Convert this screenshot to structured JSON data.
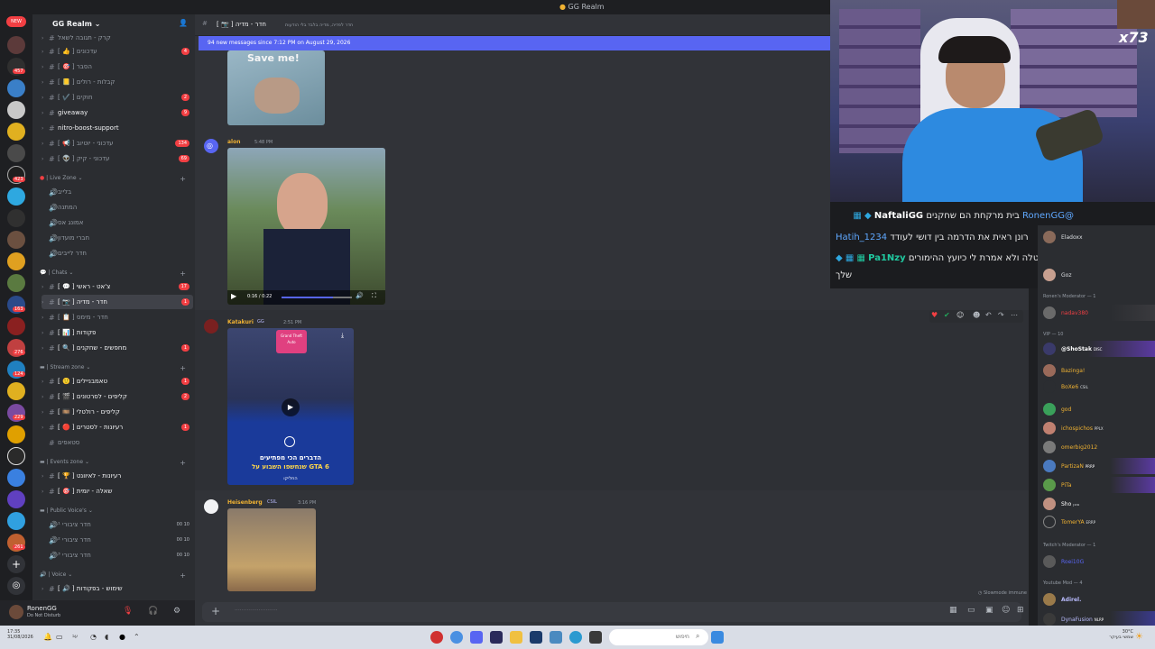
{
  "window": {
    "title": "GG Realm"
  },
  "server": {
    "name": "GG Realm",
    "badges": [
      "NEW",
      "423",
      "457",
      "163",
      "276",
      "124",
      "229",
      "261"
    ]
  },
  "channels": [
    {
      "label": "קרק - תגובה לשאל",
      "type": "text"
    },
    {
      "label": "[ 👍 ] עדכונים",
      "badge": "4"
    },
    {
      "label": "[ 🎯 ] הסבר"
    },
    {
      "label": "[ 📒 ] קבלות - רולים"
    },
    {
      "label": "[ ✔️ ] חוקים",
      "badge": "2"
    },
    {
      "label": "giveaway",
      "badge": "9"
    },
    {
      "label": "nitro-boost-support"
    },
    {
      "label": "[ 📢 ] עדכוני - יוטיוב",
      "badge": "134"
    },
    {
      "label": "[ 👽 ] עדכוני - קיק",
      "badge": "69"
    }
  ],
  "live_zone": {
    "title": "Live Zone",
    "items": [
      "בלייב",
      "המתנה",
      "אמונג אס",
      "חברי מועדון",
      "חדר לייבים"
    ]
  },
  "chats": {
    "title": "Chats",
    "items": [
      {
        "label": "[ 💬 ] צ'אט - ראשי",
        "badge": "17"
      },
      {
        "label": "[ 📷 ] חדר - מדיה",
        "badge": "1",
        "selected": true
      },
      {
        "label": "[ 📋 ] חדר - מימס"
      },
      {
        "label": "[ 📊 ] פקודות"
      },
      {
        "label": "[ 🔍 ] מחפשים - שחקנים",
        "badge": "1"
      }
    ]
  },
  "stream_zone": {
    "title": "Stream zone",
    "items": [
      {
        "label": "[ 🙂 ] טאמבניילים",
        "badge": "1"
      },
      {
        "label": "[ 🎬 ] קליפים - לסרטונים",
        "badge": "2"
      },
      {
        "label": "[ 🎞️ ] קליפים - רולטלי"
      },
      {
        "label": "[ 🔴 ] רעיונות - לסטרים",
        "badge": "1"
      },
      {
        "label": "סטאפים"
      }
    ]
  },
  "events_zone": {
    "title": "Events zone",
    "items": [
      {
        "label": "[ 🏆 ] רעיונות - לאיוונט"
      },
      {
        "label": "[ 🎯 ] שאלה - יומית"
      }
    ]
  },
  "public_voice": {
    "title": "Public Voice's",
    "items": [
      {
        "label": "חדר ציבורי ¹",
        "count": "00 10"
      },
      {
        "label": "חדר ציבורי ²",
        "count": "00 10"
      },
      {
        "label": "חדר ציבורי ³",
        "count": "00 10"
      }
    ]
  },
  "voice": {
    "title": "Voice",
    "items": [
      {
        "label": "[ 🔊 ] שימוש - בפקודות"
      }
    ]
  },
  "user": {
    "name": "RonenGG",
    "status": "Do Not Disturb"
  },
  "channel_header": {
    "name": "[ 📷 ] חדר - מדיה",
    "topic": "חדר לפדיה, מדיה בלבד בלי הודעות"
  },
  "new_messages_bar": "94 new messages since 7:12 PM on August 29, 2026",
  "messages": [
    {
      "author": "",
      "time": "",
      "image_text": "Save me!"
    },
    {
      "author": "alon",
      "time": "5:48 PM",
      "video_time": "0:16 / 0:22"
    },
    {
      "author": "Katakuri",
      "tag": "GG",
      "time": "2:51 PM",
      "image_text_1": "הדברים הכי מפתיעים",
      "image_text_2": "שנחשפו השבוע על GTA 6",
      "image_text_3": "החליקו",
      "gta_text": "Grand Theft Auto"
    },
    {
      "author": "Heisenberg",
      "tag": "CSIL",
      "time": "3:16 PM"
    }
  ],
  "composer": {
    "placeholder": "·························"
  },
  "slowmode": "Slowmode immune",
  "webcam": {
    "overlay_text": "x73"
  },
  "twitch_chat": [
    {
      "user": "NaftaliGG",
      "text": "בית מרקחת הם שחקנים",
      "mention": "@RonenGG"
    },
    {
      "user": "Hatih_1234",
      "text": "רונן ראית את הדרמה בין דושי לעודד"
    },
    {
      "user": "Pa1Nzy",
      "text": "פה שיש חסות חדשה? נסטלה ולא אמרת לי כיועץ ההימורים",
      "text2": "שלך"
    }
  ],
  "members": {
    "top": [
      "Eladoxx",
      "Goz"
    ],
    "groups": [
      {
        "title": "Ronen's Moderator — 1",
        "items": [
          {
            "name": "nadav380",
            "color": "#f23f43"
          }
        ]
      },
      {
        "title": "VIP — 10",
        "items": [
          {
            "name": "@ShoStak",
            "tag": "DISC",
            "color": "#ffffff",
            "sub": "2key"
          },
          {
            "name": "Bazinga!",
            "color": "#f0b232"
          },
          {
            "name": "BoXe6",
            "tag": "CSIL",
            "color": "#f0b232"
          },
          {
            "name": "god",
            "color": "#f0b232"
          },
          {
            "name": "ichospichos",
            "tag": "PPLX",
            "color": "#f0b232"
          },
          {
            "name": "omerbig2012",
            "color": "#f0b232"
          },
          {
            "name": "PartizaN",
            "tag": "PRRP",
            "color": "#f0b232"
          },
          {
            "name": "PiTa",
            "color": "#f0b232"
          },
          {
            "name": "Sho",
            "tag": "סוכן",
            "color": "#ffffff"
          },
          {
            "name": "TomerYA",
            "tag": "ERRP",
            "color": "#f0b232"
          }
        ]
      },
      {
        "title": "Twitch's Moderator — 1",
        "items": [
          {
            "name": "Roei10G",
            "color": "#5865f2"
          }
        ]
      },
      {
        "title": "Youtube Mod — 4",
        "items": [
          {
            "name": "Adirel.",
            "color": "#b9bbfd"
          },
          {
            "name": "DynaFusion",
            "tag": "NLRP",
            "color": "#b9bbfd"
          }
        ]
      }
    ]
  },
  "taskbar": {
    "left_time": "17:35",
    "left_date": "31/08/2026",
    "lang": "עב",
    "search_placeholder": "חיפוש",
    "weather_temp": "30°C",
    "weather_text": "שמשי בעיקר"
  },
  "colors": {
    "accent": "#5865f2",
    "danger": "#f23f43",
    "twitch_name": "#5fa8ff",
    "highlight": "#20c9a0"
  }
}
